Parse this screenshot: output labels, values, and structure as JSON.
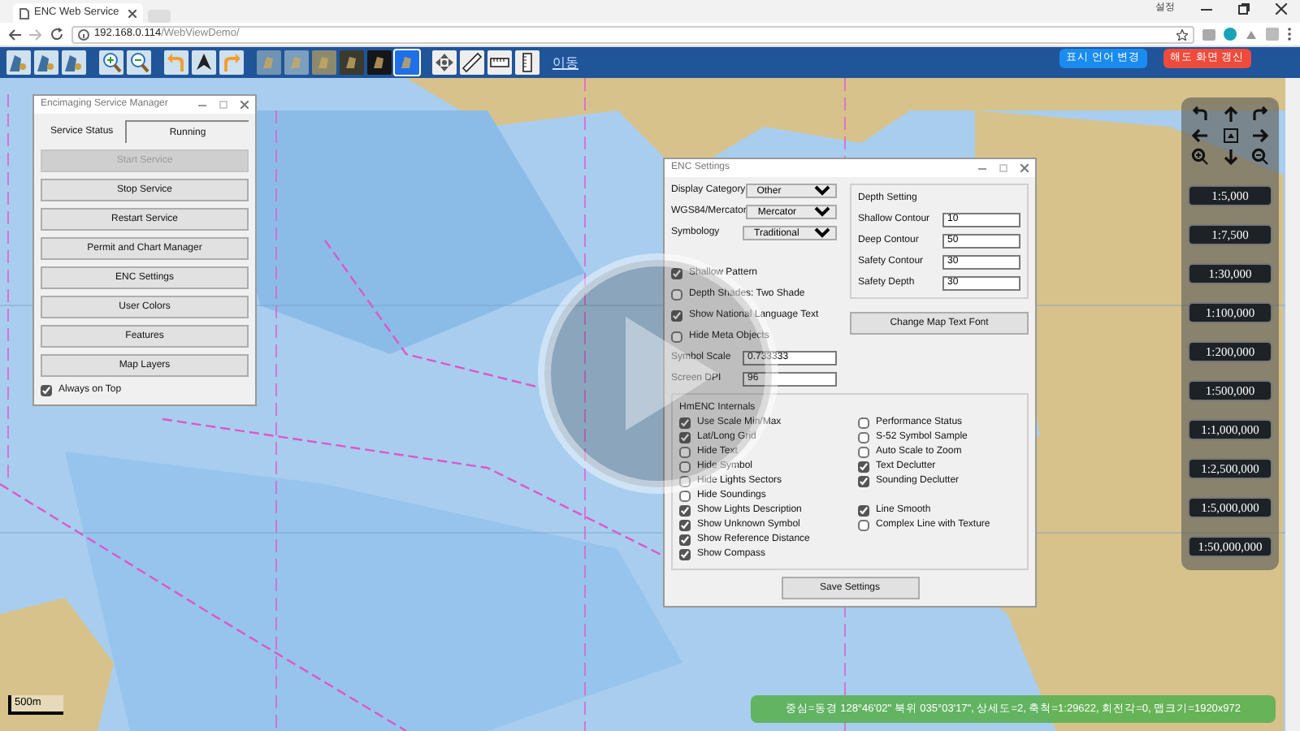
{
  "browser": {
    "tab_title": "ENC Web Service",
    "url_host": "192.168.0.114",
    "url_path": "/WebViewDemo/",
    "window_label": "설정"
  },
  "toolbar": {
    "tools": [
      {
        "kind": "chart"
      },
      {
        "kind": "chart"
      },
      {
        "kind": "chart"
      },
      {
        "kind": "zoom-in"
      },
      {
        "kind": "zoom-out"
      },
      {
        "kind": "rotate-left"
      },
      {
        "kind": "north"
      },
      {
        "kind": "rotate-right"
      }
    ],
    "palettes": [
      {
        "color": "#6f93b3",
        "selected": false
      },
      {
        "color": "#7b9fbd",
        "selected": false
      },
      {
        "color": "#8b8a6e",
        "selected": false
      },
      {
        "color": "#3b3a2e",
        "selected": false
      },
      {
        "color": "#15161a",
        "selected": false
      },
      {
        "color": "#1f6fe8",
        "selected": true
      }
    ],
    "measure_tools": [
      {
        "kind": "pan"
      },
      {
        "kind": "ruler"
      },
      {
        "kind": "scale"
      },
      {
        "kind": "ruler-vertical"
      }
    ],
    "link": "이동"
  },
  "header_buttons": [
    {
      "label": "표시 언어 변경",
      "kind": "primary"
    },
    {
      "label": "해도 화면 갱신",
      "kind": "danger"
    }
  ],
  "service_manager": {
    "title": "Encimaging Service Manager",
    "status_label": "Service Status",
    "status_value": "Running",
    "buttons": [
      {
        "label": "Start Service",
        "disabled": true
      },
      {
        "label": "Stop Service",
        "disabled": false
      },
      {
        "label": "Restart Service",
        "disabled": false
      },
      {
        "label": "Permit and Chart Manager",
        "disabled": false
      },
      {
        "label": "ENC Settings",
        "disabled": false
      },
      {
        "label": "User Colors",
        "disabled": false
      },
      {
        "label": "Features",
        "disabled": false
      },
      {
        "label": "Map Layers",
        "disabled": false
      }
    ],
    "always_on_top": {
      "label": "Always on Top",
      "checked": true
    }
  },
  "enc_settings": {
    "title": "ENC Settings",
    "selects": [
      {
        "label": "Display Category",
        "value": "Other"
      },
      {
        "label": "WGS84/Mercator",
        "value": "Mercator"
      },
      {
        "label": "Symbology",
        "value": "Traditional"
      }
    ],
    "depth_title": "Depth Setting",
    "depth_fields": [
      {
        "label": "Shallow Contour",
        "value": "10"
      },
      {
        "label": "Deep Contour",
        "value": "50"
      },
      {
        "label": "Safety Contour",
        "value": "30"
      },
      {
        "label": "Safety Depth",
        "value": "30"
      }
    ],
    "options": [
      {
        "label": "Shallow Pattern",
        "checked": true
      },
      {
        "label": "Depth Shades: Two Shade",
        "checked": false
      },
      {
        "label": "Show National Language Text",
        "checked": true
      },
      {
        "label": "Hide Meta Objects",
        "checked": false
      }
    ],
    "font_button": "Change Map Text Font",
    "inputs": [
      {
        "label": "Symbol Scale",
        "value": "0.733333"
      },
      {
        "label": "Screen DPI",
        "value": "96"
      }
    ],
    "internals_title": "HmENC Internals",
    "internals_left": [
      {
        "label": "Use Scale Min/Max",
        "checked": true
      },
      {
        "label": "Lat/Long Grid",
        "checked": true
      },
      {
        "label": "Hide Text",
        "checked": false
      },
      {
        "label": "Hide Symbol",
        "checked": false
      },
      {
        "label": "Hide Lights Sectors",
        "checked": false
      },
      {
        "label": "Hide Soundings",
        "checked": false
      },
      {
        "label": "Show Lights Description",
        "checked": true
      },
      {
        "label": "Show Unknown Symbol",
        "checked": true
      },
      {
        "label": "Show Reference Distance",
        "checked": true
      },
      {
        "label": "Show Compass",
        "checked": true
      }
    ],
    "internals_right": [
      {
        "label": "Performance Status",
        "checked": false
      },
      {
        "label": "S-52 Symbol Sample",
        "checked": false
      },
      {
        "label": "Auto Scale to Zoom",
        "checked": false
      },
      {
        "label": "Text Declutter",
        "checked": true
      },
      {
        "label": "Sounding Declutter",
        "checked": true
      },
      {
        "label": "Line Smooth",
        "checked": true
      },
      {
        "label": "Complex Line with Texture",
        "checked": false
      }
    ],
    "save_button": "Save Settings"
  },
  "navigation": {
    "controls": [
      {
        "kind": "rotate-left"
      },
      {
        "kind": "up"
      },
      {
        "kind": "rotate-right"
      },
      {
        "kind": "left"
      },
      {
        "kind": "center"
      },
      {
        "kind": "right"
      },
      {
        "kind": "zoom-in"
      },
      {
        "kind": "down"
      },
      {
        "kind": "zoom-out"
      }
    ],
    "scales": [
      {
        "label": "1:5,000",
        "selected": false
      },
      {
        "label": "1:7,500",
        "selected": false
      },
      {
        "label": "1:30,000",
        "selected": false
      },
      {
        "label": "1:100,000",
        "selected": false
      },
      {
        "label": "1:200,000",
        "selected": false
      },
      {
        "label": "1:500,000",
        "selected": false
      },
      {
        "label": "1:1,000,000",
        "selected": false
      },
      {
        "label": "1:2,500,000",
        "selected": false
      },
      {
        "label": "1:5,000,000",
        "selected": false
      },
      {
        "label": "1:50,000,000",
        "selected": false
      }
    ]
  },
  "map_scale": "500m",
  "status_bar": "중심=동경 128°46'02\" 북위 035°03'17\", 상세도=2, 축척=1:29622, 회전각=0, 맵크기=1920x972"
}
